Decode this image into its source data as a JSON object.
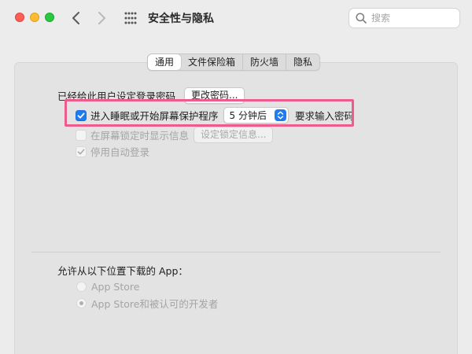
{
  "window": {
    "title": "安全性与隐私"
  },
  "search": {
    "placeholder": "搜索",
    "value": ""
  },
  "tabs": [
    {
      "label": "通用",
      "active": true
    },
    {
      "label": "文件保险箱",
      "active": false
    },
    {
      "label": "防火墙",
      "active": false
    },
    {
      "label": "隐私",
      "active": false
    }
  ],
  "general": {
    "password_set_label": "已经给此用户设定登录密码",
    "change_password_button": "更改密码...",
    "require_password": {
      "checked": true,
      "label_before": "进入睡眠或开始屏幕保护程序",
      "delay_value": "5 分钟后",
      "label_after": "要求输入密码"
    },
    "show_message": {
      "checked": false,
      "enabled": false,
      "label": "在屏幕锁定时显示信息",
      "button": "设定锁定信息..."
    },
    "disable_auto_login": {
      "checked": true,
      "enabled": false,
      "label": "停用自动登录"
    }
  },
  "downloads": {
    "heading": "允许从以下位置下载的 App：",
    "options": [
      {
        "label": "App Store",
        "selected": false,
        "enabled": false
      },
      {
        "label": "App Store和被认可的开发者",
        "selected": true,
        "enabled": false
      }
    ]
  },
  "colors": {
    "accent": "#1f7cf0",
    "highlight_box": "#ee5b8d",
    "traffic_close": "#fe5f57",
    "traffic_min": "#febc2e",
    "traffic_max": "#28c840"
  }
}
